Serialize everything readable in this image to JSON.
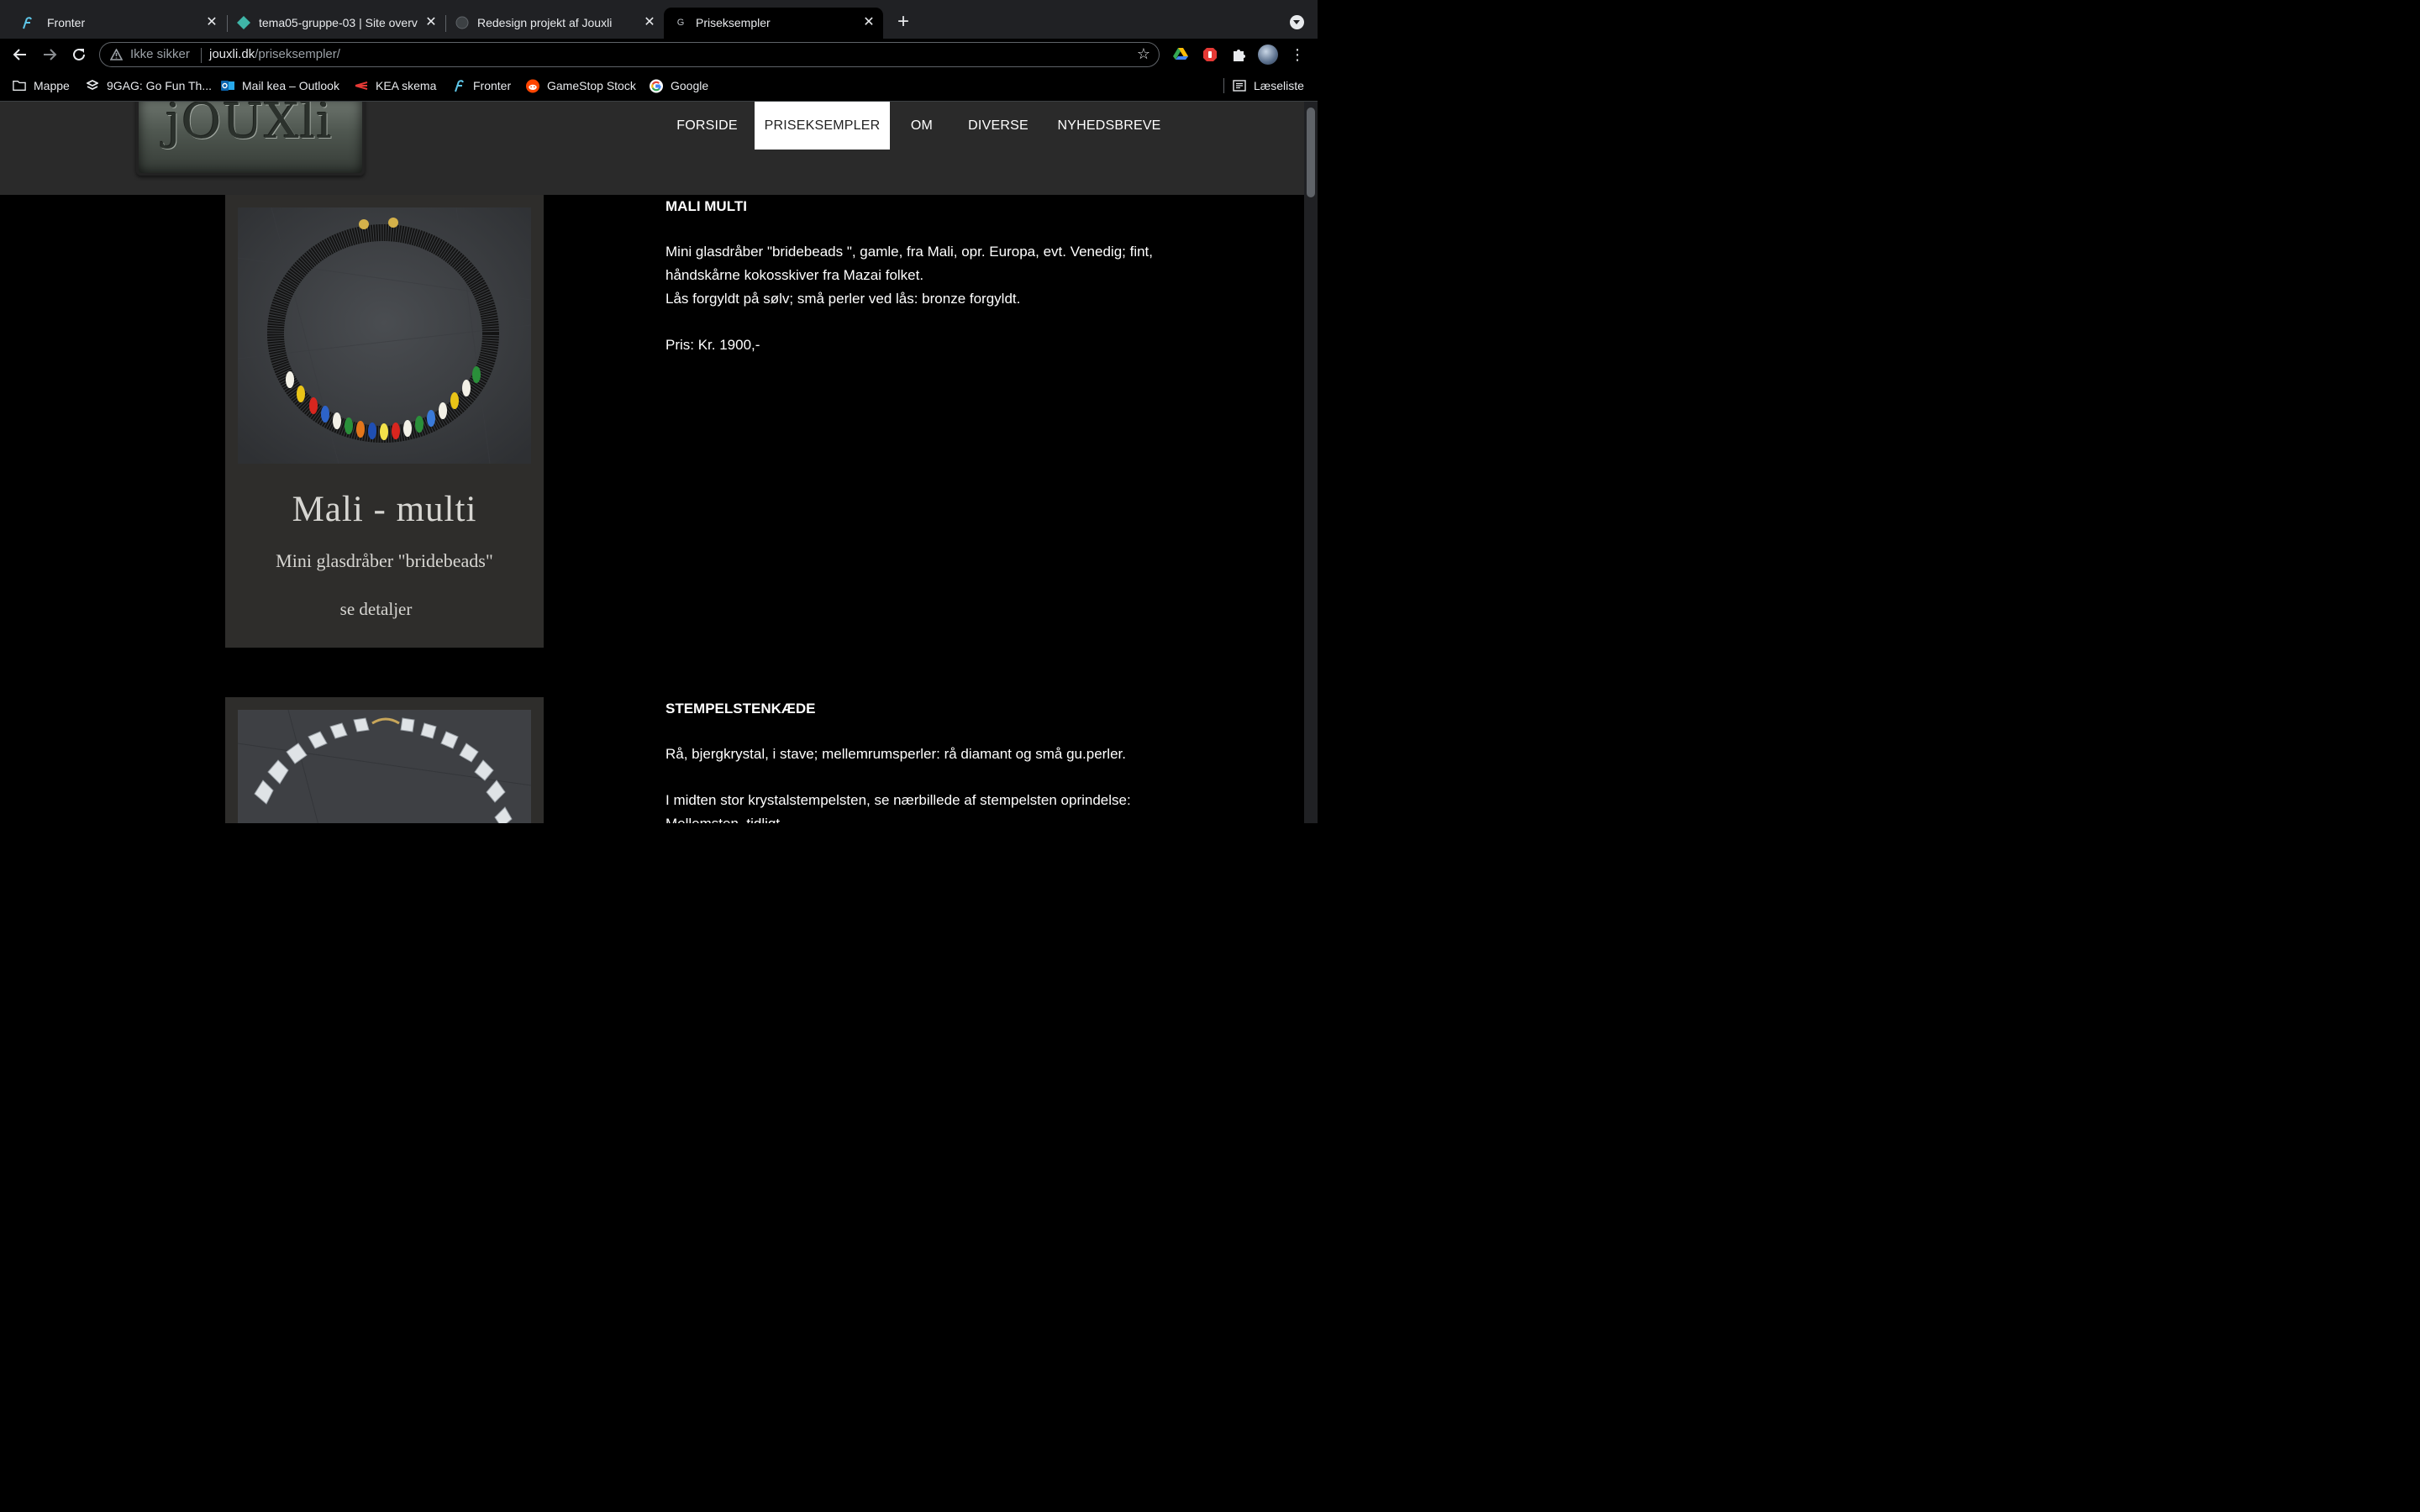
{
  "tabs": [
    {
      "title": "Fronter",
      "icon": "fronter-icon"
    },
    {
      "title": "tema05-gruppe-03 | Site overv",
      "icon": "netlify-icon"
    },
    {
      "title": "Redesign projekt af Jouxli",
      "icon": "globe-icon"
    },
    {
      "title": "Priseksempler",
      "icon": "default-page-icon",
      "active": true
    }
  ],
  "toolbar": {
    "security_label": "Ikke sikker",
    "url_host": "jouxli.dk",
    "url_path": "/priseksempler/"
  },
  "bookmarks": [
    {
      "label": "Mappe",
      "icon": "folder-icon"
    },
    {
      "label": "9GAG: Go Fun Th...",
      "icon": "9gag-icon"
    },
    {
      "label": "Mail kea – Outlook",
      "icon": "outlook-icon"
    },
    {
      "label": "KEA skema",
      "icon": "kea-icon"
    },
    {
      "label": "Fronter",
      "icon": "fronter-icon"
    },
    {
      "label": "GameStop Stock",
      "icon": "reddit-icon"
    },
    {
      "label": "Google",
      "icon": "google-icon"
    }
  ],
  "reading_list_label": "Læseliste",
  "site": {
    "logo_text": "jOUXli",
    "nav": [
      "FORSIDE",
      "PRISEKSEMPLER",
      "OM",
      "DIVERSE",
      "NYHEDSBREVE"
    ],
    "active_nav": "PRISEKSEMPLER"
  },
  "products": [
    {
      "card_title": "Mali - multi",
      "card_subtitle": "Mini glasdråber \"bridebeads\"",
      "card_link": "se detaljer",
      "title": "MALI MULTI",
      "desc_line1": "Mini glasdråber \"bridebeads \", gamle, fra Mali, opr. Europa, evt. Venedig; fint,",
      "desc_line2": "håndskårne kokosskiver fra Mazai folket.",
      "desc_line3": "Lås forgyldt på sølv; små perler ved lås: bronze forgyldt.",
      "price": "Pris: Kr. 1900,-"
    },
    {
      "title": "STEMPELSTENKÆDE",
      "desc_line1": "Rå, bjergkrystal, i stave; mellemrumsperler: rå diamant og små gu.perler.",
      "desc_line2": "I midten stor krystalstempelsten, se nærbillede af stempelsten oprindelse:",
      "desc_line3": "Mellemsten, tidligt"
    }
  ],
  "colors": {
    "browser_frame": "#202124",
    "site_header": "#2a2a2a",
    "page_bg": "#000000",
    "card_bg": "#2e2d2b"
  }
}
